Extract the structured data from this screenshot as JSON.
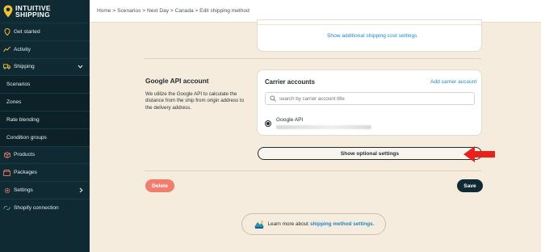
{
  "brand": {
    "line1": "INTUITIVE",
    "line2": "SHIPPING"
  },
  "breadcrumb": "Home > Scenarios > Next Day > Canada > Edit shipping method",
  "sidebar": {
    "items": [
      {
        "label": "Get started",
        "icon": "map-pin-icon"
      },
      {
        "label": "Activity",
        "icon": "activity-chart-icon"
      },
      {
        "label": "Shipping",
        "icon": "truck-icon"
      },
      {
        "label": "Scenarios"
      },
      {
        "label": "Zones"
      },
      {
        "label": "Rate blending"
      },
      {
        "label": "Condition groups"
      },
      {
        "label": "Products",
        "icon": "box-icon"
      },
      {
        "label": "Packages",
        "icon": "package-icon"
      },
      {
        "label": "Settings",
        "icon": "gear-icon"
      },
      {
        "label": "Shopify connection",
        "icon": "link-icon"
      }
    ]
  },
  "top_card": {
    "link": "Show additional shipping cost settings"
  },
  "google_section": {
    "title": "Google API account",
    "description": "We utilize the Google API to calculate the distance from the ship from origin address to the delivery address."
  },
  "carrier": {
    "title": "Carrier accounts",
    "add_link": "Add carrier account",
    "search_placeholder": "search by carrier account title",
    "account_name": "Google API"
  },
  "optional_button": "Show optional settings",
  "actions": {
    "delete": "Delete",
    "save": "Save"
  },
  "learn_more": {
    "prefix": "Learn more about",
    "link": "shipping method settings."
  },
  "colors": {
    "sidebar": "#0f2a33",
    "accent_link": "#1f86c7",
    "delete": "#ef7e6e",
    "arrow": "#e8211d",
    "page_bg": "#f5ecdd"
  }
}
